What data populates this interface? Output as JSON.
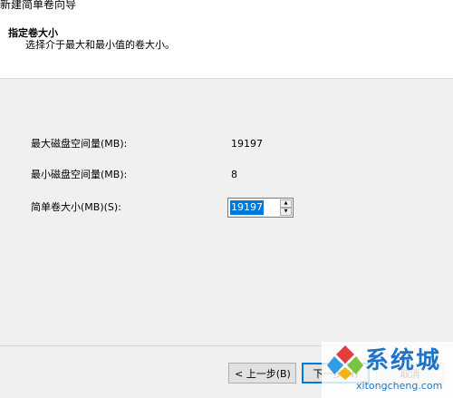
{
  "window": {
    "title": "新建简单卷向导"
  },
  "header": {
    "title": "指定卷大小",
    "subtitle": "选择介于最大和最小值的卷大小。"
  },
  "fields": {
    "max_label": "最大磁盘空间量(MB):",
    "max_value": "19197",
    "min_label": "最小磁盘空间量(MB):",
    "min_value": "8",
    "size_label": "简单卷大小(MB)(S):",
    "size_value": "19197"
  },
  "buttons": {
    "back": "< 上一步(B)",
    "next": "下一步(N)",
    "cancel": "取消"
  },
  "watermark": {
    "brand_cn": "系统城",
    "brand_en": "xitongcheng.com"
  },
  "colors": {
    "selection": "#0078d7",
    "brand": "#1e74c8"
  }
}
